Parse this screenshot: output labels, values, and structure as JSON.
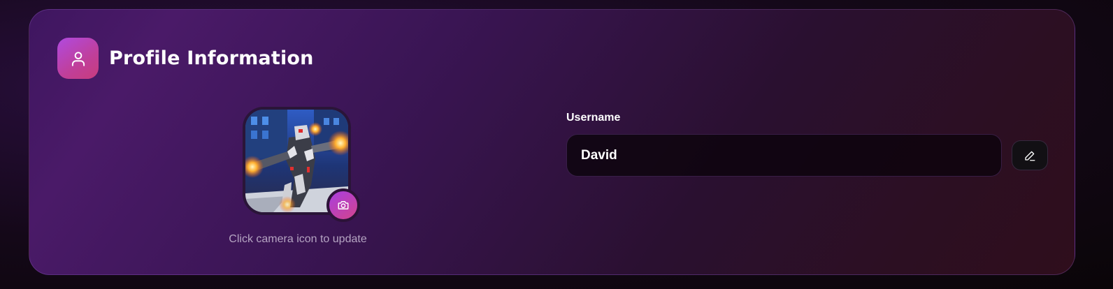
{
  "profile": {
    "title": "Profile Information",
    "header_icon": "user-icon",
    "avatar": {
      "alt": "Profile avatar",
      "camera_icon": "camera-icon",
      "hint": "Click camera icon to update"
    },
    "username": {
      "label": "Username",
      "value": "David",
      "edit_icon": "pencil-icon"
    }
  },
  "colors": {
    "accent_start": "#b04ae0",
    "accent_end": "#d2448c",
    "card_bg": "#3a1554",
    "input_bg": "#0c040c"
  }
}
